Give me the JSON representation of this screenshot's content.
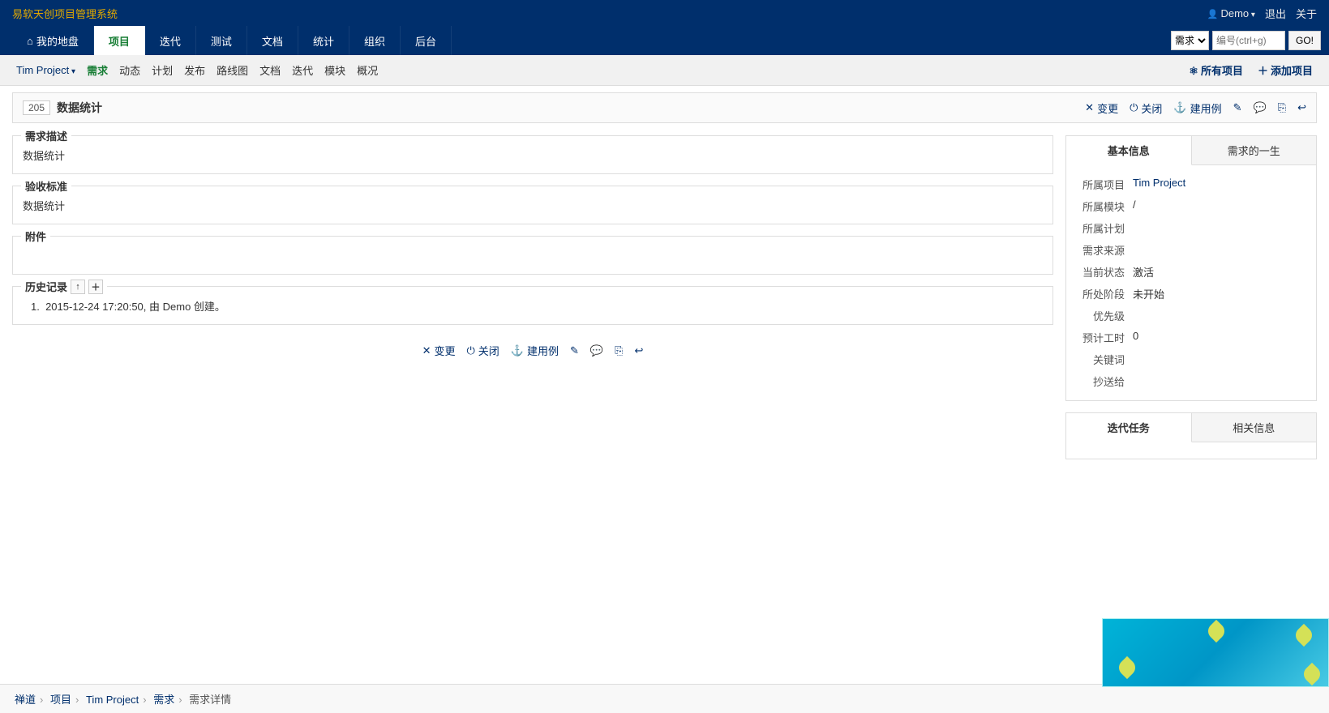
{
  "header": {
    "brand": "易软天创项目管理系统",
    "user": "Demo",
    "logout": "退出",
    "about": "关于"
  },
  "mainnav": {
    "tabs": [
      {
        "label": "我的地盘",
        "icon": "home"
      },
      {
        "label": "项目",
        "active": true
      },
      {
        "label": "迭代"
      },
      {
        "label": "测试"
      },
      {
        "label": "文档"
      },
      {
        "label": "统计"
      },
      {
        "label": "组织"
      },
      {
        "label": "后台"
      }
    ],
    "search": {
      "type": "需求",
      "placeholder": "编号(ctrl+g)",
      "go": "GO!"
    }
  },
  "subnav": {
    "project": "Tim Project",
    "items": [
      "需求",
      "动态",
      "计划",
      "发布",
      "路线图",
      "文档",
      "迭代",
      "模块",
      "概况"
    ],
    "active": "需求",
    "right": {
      "all_projects": "所有项目",
      "add_project": "添加项目"
    }
  },
  "titlebar": {
    "id": "205",
    "title": "数据统计",
    "actions": {
      "change": "变更",
      "close": "关闭",
      "create_case": "建用例"
    }
  },
  "sections": {
    "desc": {
      "legend": "需求描述",
      "body": "数据统计"
    },
    "acceptance": {
      "legend": "验收标准",
      "body": "数据统计"
    },
    "attachment": {
      "legend": "附件",
      "body": ""
    },
    "history": {
      "legend": "历史记录",
      "items": [
        "2015-12-24 17:20:50, 由 Demo 创建。"
      ]
    }
  },
  "sidebar": {
    "basic": {
      "tab1": "基本信息",
      "tab2": "需求的一生",
      "rows": {
        "project_label": "所属项目",
        "project_value": "Tim Project",
        "module_label": "所属模块",
        "module_value": "/",
        "plan_label": "所属计划",
        "plan_value": "",
        "source_label": "需求来源",
        "source_value": "",
        "status_label": "当前状态",
        "status_value": "激活",
        "stage_label": "所处阶段",
        "stage_value": "未开始",
        "priority_label": "优先级",
        "priority_value": "",
        "estimate_label": "预计工时",
        "estimate_value": "0",
        "keyword_label": "关键词",
        "keyword_value": "",
        "cc_label": "抄送给",
        "cc_value": ""
      }
    },
    "related": {
      "tab1": "迭代任务",
      "tab2": "相关信息"
    }
  },
  "breadcrumb": {
    "items": [
      "禅道",
      "项目",
      "Tim Project",
      "需求",
      "需求详情"
    ]
  }
}
